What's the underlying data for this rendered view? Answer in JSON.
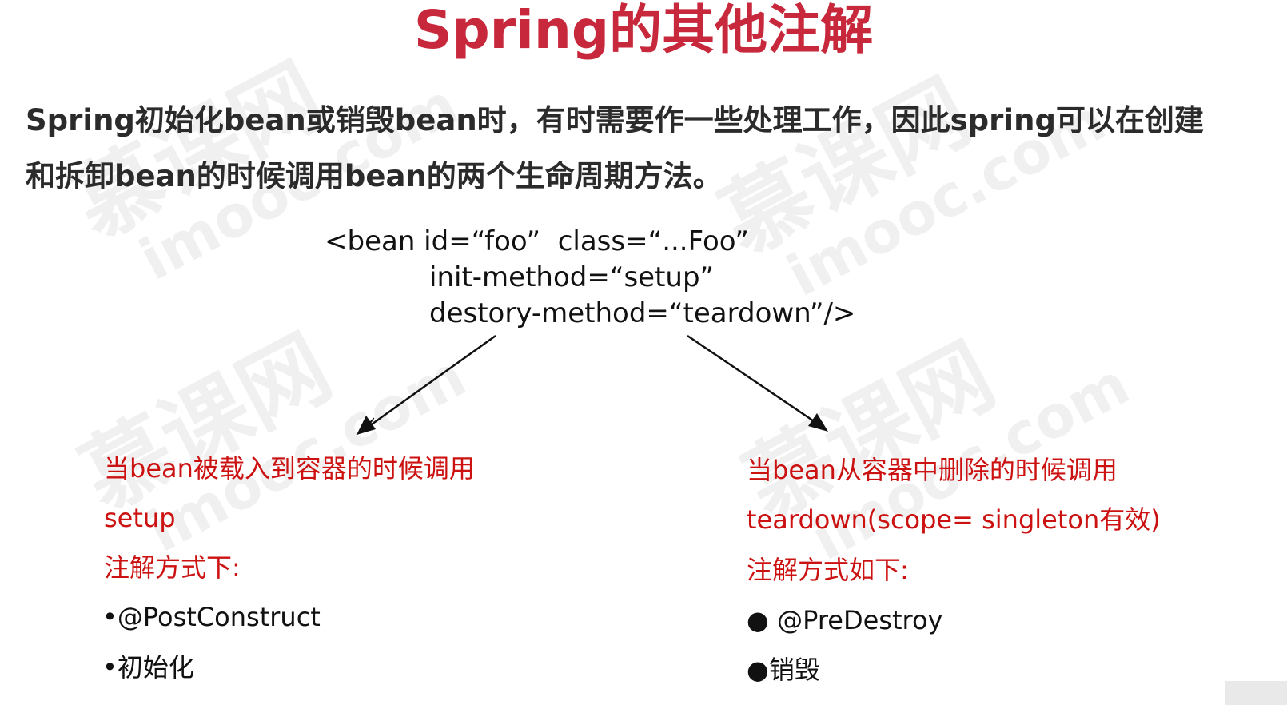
{
  "slide": {
    "title": "Spring的其他注解",
    "intro_line1": "Spring初始化bean或销毁bean时，有时需要作一些处理工作，因此spring可以在创建",
    "intro_line2": "和拆卸bean的时候调用bean的两个生命周期方法。",
    "code_line1": "<bean id=“foo”  class=“...Foo”",
    "code_line2": "init-method=“setup”",
    "code_line3": "destory-method=“teardown”/>",
    "left": {
      "desc": "当bean被载入到容器的时候调用",
      "method": "setup",
      "annotation_heading": "注解方式下:",
      "annotation": "•@PostConstruct",
      "meaning": "•初始化"
    },
    "right": {
      "desc": "当bean从容器中删除的时候调用",
      "method": "teardown(scope= singleton有效)",
      "annotation_heading": "注解方式如下:",
      "annotation": "● @PreDestroy",
      "meaning": "●销毁"
    }
  },
  "watermark": {
    "cn": "慕课网",
    "en": "imooc.com"
  },
  "colors": {
    "title": "#c8283c",
    "intro_text": "#2b2b2b",
    "highlight_red": "#cc1111",
    "body_text": "#111111"
  }
}
